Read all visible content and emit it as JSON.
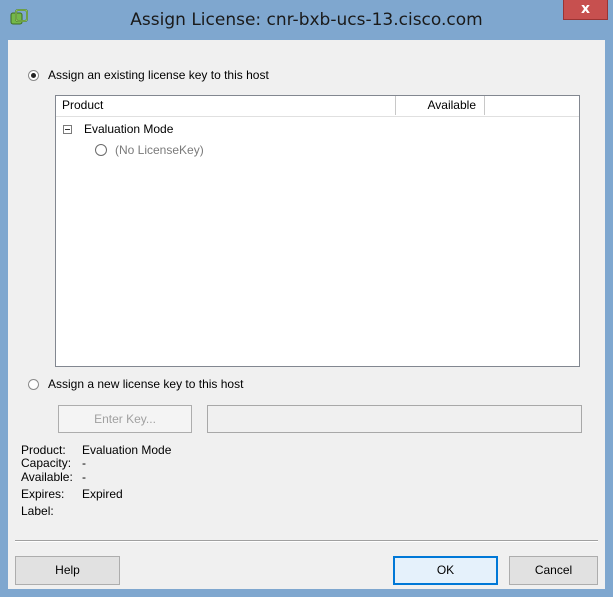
{
  "window": {
    "title": "Assign License: cnr-bxb-ucs-13.cisco.com",
    "close_label": "x"
  },
  "options": {
    "existing_label": "Assign an existing license key to this host",
    "new_label": "Assign a new license key to this host",
    "selected": "existing"
  },
  "license_list": {
    "columns": [
      "Product",
      "Available",
      ""
    ],
    "group_label": "Evaluation Mode",
    "item_label": "(No LicenseKey)"
  },
  "enter_key": {
    "button_label": "Enter Key...",
    "field_value": ""
  },
  "details": {
    "product_label": "Product:",
    "product_value": "Evaluation Mode",
    "capacity_label": "Capacity:",
    "capacity_value": "-",
    "available_label": "Available:",
    "available_value": "-",
    "expires_label": "Expires:",
    "expires_value": "Expired",
    "label_label": "Label:",
    "label_value": ""
  },
  "footer": {
    "help_label": "Help",
    "ok_label": "OK",
    "cancel_label": "Cancel"
  },
  "colors": {
    "titlebar": "#7fa7cf",
    "close_button": "#c7504f",
    "dialog_background": "#f0f0f0",
    "default_button_border": "#0078d7"
  },
  "icons": {
    "app": "vsphere-app-icon",
    "close": "close-icon"
  }
}
